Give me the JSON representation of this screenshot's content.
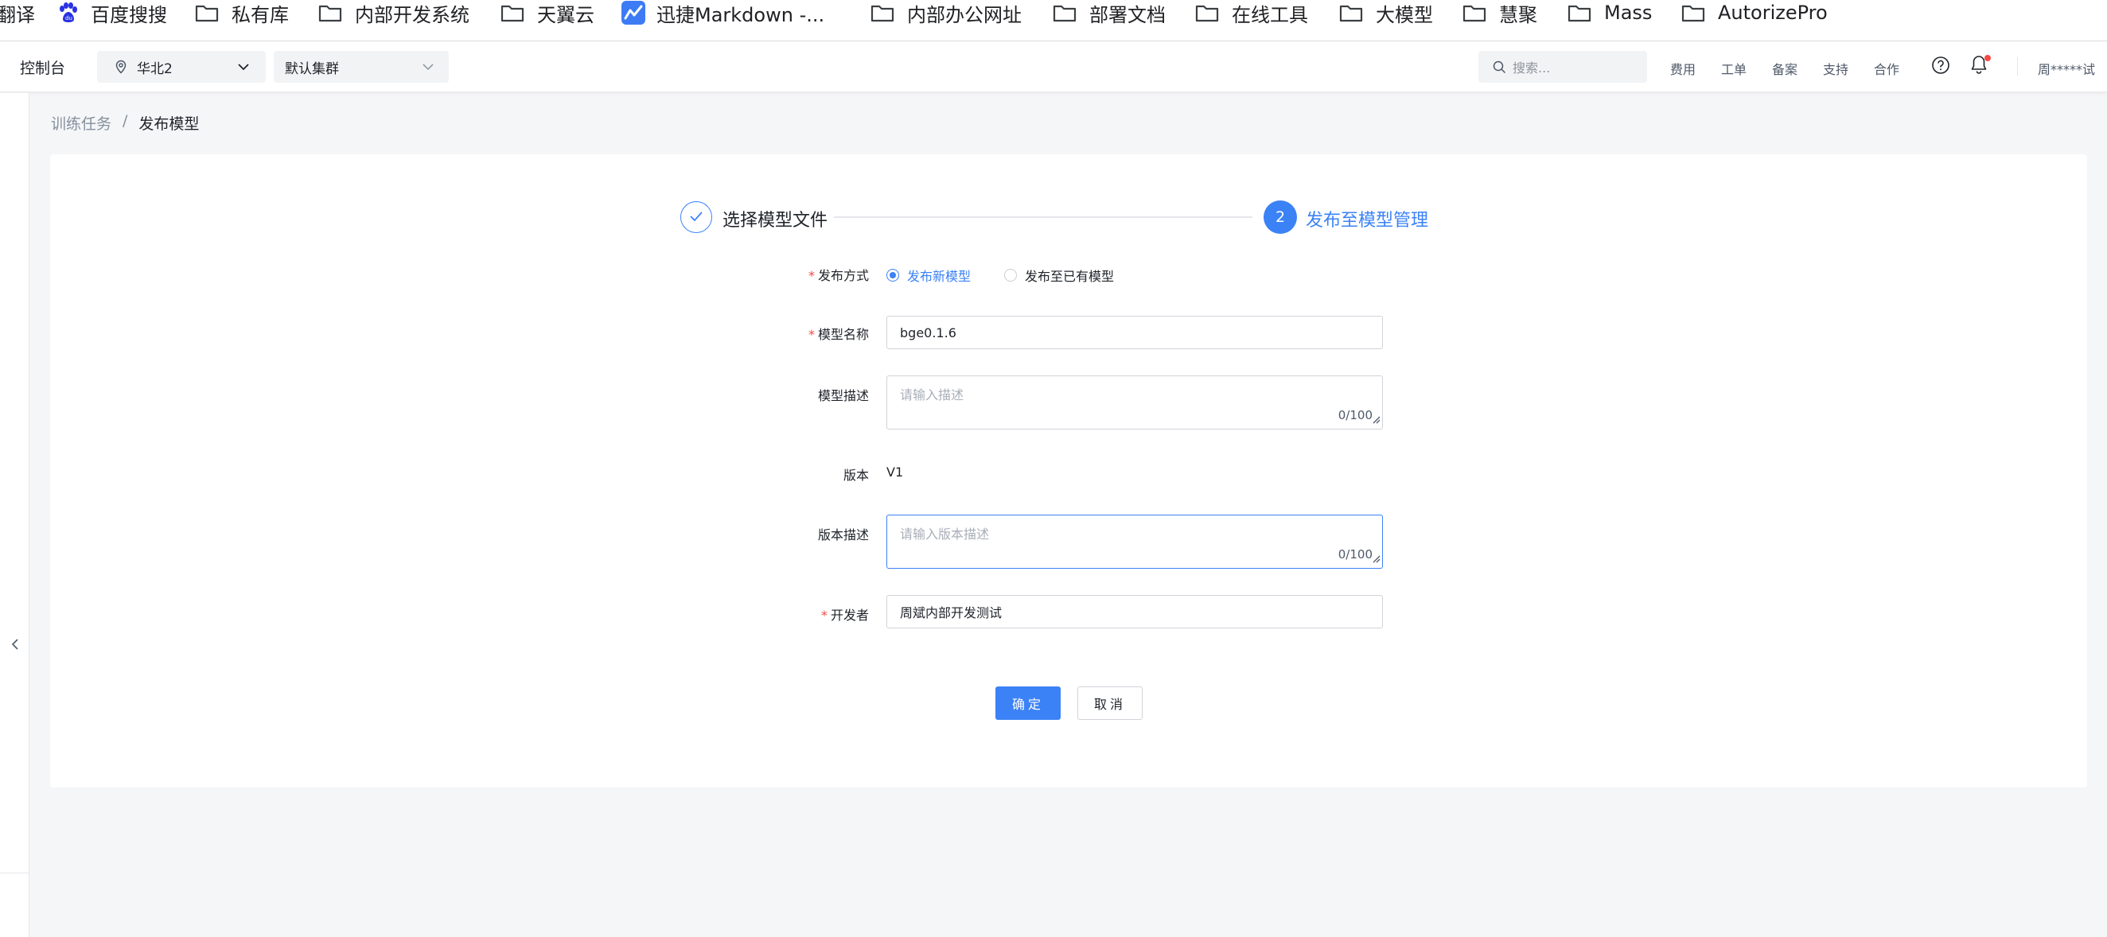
{
  "bookmarks": [
    {
      "label": "翻译",
      "icon": "none"
    },
    {
      "label": "百度搜搜",
      "icon": "baidu-paw-icon"
    },
    {
      "label": "私有库",
      "icon": "folder-icon"
    },
    {
      "label": "内部开发系统",
      "icon": "folder-icon"
    },
    {
      "label": "天翼云",
      "icon": "folder-icon"
    },
    {
      "label": "迅捷Markdown -...",
      "icon": "markdown-app-icon"
    },
    {
      "label": "内部办公网址",
      "icon": "folder-icon"
    },
    {
      "label": "部署文档",
      "icon": "folder-icon"
    },
    {
      "label": "在线工具",
      "icon": "folder-icon"
    },
    {
      "label": "大模型",
      "icon": "folder-icon"
    },
    {
      "label": "慧聚",
      "icon": "folder-icon"
    },
    {
      "label": "Mass",
      "icon": "folder-icon"
    },
    {
      "label": "AutorizePro",
      "icon": "folder-icon"
    }
  ],
  "topnav": {
    "console": "控制台",
    "region": "华北2",
    "cluster": "默认集群",
    "search_placeholder": "搜索...",
    "links": [
      "费用",
      "工单",
      "备案",
      "支持",
      "合作"
    ],
    "user": "周*****试"
  },
  "breadcrumb": {
    "parent": "训练任务",
    "separator": "/",
    "current": "发布模型"
  },
  "steps": [
    {
      "label": "选择模型文件",
      "status": "done"
    },
    {
      "number": "2",
      "label": "发布至模型管理",
      "status": "active"
    }
  ],
  "form": {
    "publish_mode": {
      "label": "发布方式",
      "required": true,
      "options": [
        "发布新模型",
        "发布至已有模型"
      ],
      "selected": "发布新模型"
    },
    "model_name": {
      "label": "模型名称",
      "required": true,
      "value": "bge0.1.6"
    },
    "model_desc": {
      "label": "模型描述",
      "placeholder": "请输入描述",
      "count": "0/100"
    },
    "version": {
      "label": "版本",
      "value": "V1"
    },
    "version_desc": {
      "label": "版本描述",
      "placeholder": "请输入版本描述",
      "count": "0/100"
    },
    "developer": {
      "label": "开发者",
      "required": true,
      "value": "周斌内部开发测试"
    },
    "required_mark": "*"
  },
  "actions": {
    "confirm": "确定",
    "cancel": "取消"
  },
  "colors": {
    "primary": "#3b82f6",
    "required": "#f54a45",
    "notification_dot": "#f54a45"
  }
}
